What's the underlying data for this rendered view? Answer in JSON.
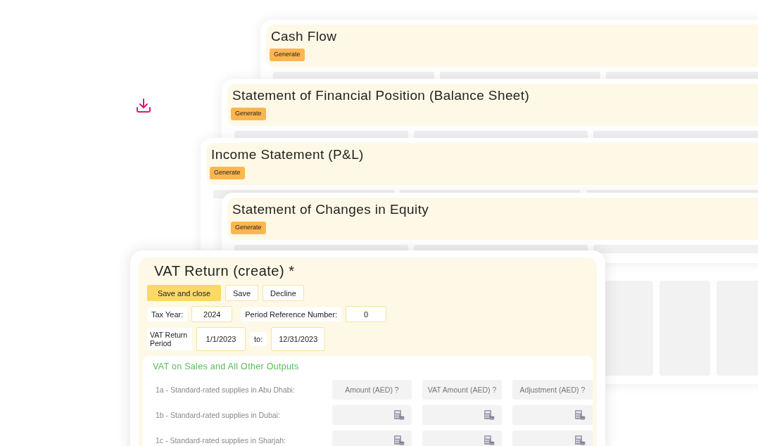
{
  "reports": [
    {
      "title": "Cash Flow",
      "button": "Generate",
      "kind": "bars"
    },
    {
      "title": "Statement of Financial Position (Balance Sheet)",
      "button": "Generate",
      "kind": "bars"
    },
    {
      "title": "Income Statement (P&L)",
      "button": "Generate",
      "kind": "blocks"
    },
    {
      "title": "Statement of Changes in Equity",
      "button": "Generate",
      "kind": "bars"
    }
  ],
  "vat_return": {
    "title": "VAT Return (create) *",
    "buttons": [
      {
        "label": "Save and close",
        "kind": "primary"
      },
      {
        "label": "Save",
        "kind": "secondary"
      },
      {
        "label": "Decline",
        "kind": "secondary"
      }
    ],
    "tax_year_label": "Tax Year:",
    "tax_year": "2024",
    "period_ref_label": "Period Reference Number:",
    "period_ref": "0",
    "period_label": "VAT Return Period",
    "period_from": "1/1/2023",
    "to_label": "to:",
    "period_to": "12/31/2023",
    "section_title": "VAT on Sales and All Other Outputs",
    "header_row": {
      "label": "1a - Standard-rated supplies in Abu Dhabi:",
      "columns": [
        "Amount (AED) ?",
        "VAT Amount (AED) ?",
        "Adjustment (AED) ?"
      ]
    },
    "rows": [
      {
        "label": "1b - Standard-rated supplies in Dubai:"
      },
      {
        "label": "1c - Standard-rated supplies in Sharjah:"
      }
    ]
  }
}
